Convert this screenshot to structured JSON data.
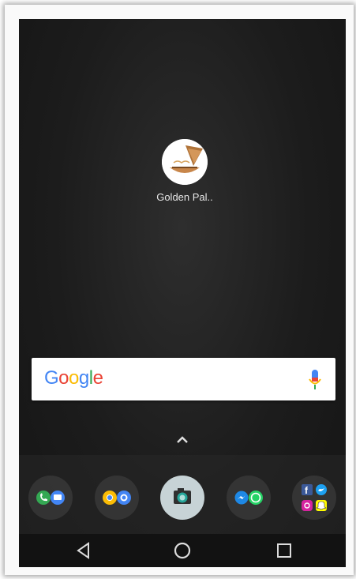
{
  "home_screen": {
    "app": {
      "label": "Golden Pal..",
      "icon": "golden-palace-icon"
    }
  },
  "search_bar": {
    "logo_text": [
      "G",
      "o",
      "o",
      "g",
      "l",
      "e"
    ],
    "logo_colors": [
      "#4285F4",
      "#EA4335",
      "#FBBC05",
      "#4285F4",
      "#34A853",
      "#EA4335"
    ],
    "mic_icon": "mic-icon"
  },
  "app_drawer_hint": {
    "icon": "chevron-up-icon"
  },
  "dock": {
    "items": [
      {
        "name": "phone-messages-folder",
        "icons": [
          "phone-icon",
          "messages-icon"
        ]
      },
      {
        "name": "chrome-folder",
        "icons": [
          "chrome-icon",
          "duo-icon"
        ]
      },
      {
        "name": "camera-app",
        "icons": [
          "camera-icon"
        ]
      },
      {
        "name": "messenger-whatsapp-folder",
        "icons": [
          "messenger-icon",
          "whatsapp-icon"
        ]
      },
      {
        "name": "social-folder",
        "icons": [
          "facebook-icon",
          "twitter-icon",
          "instagram-icon",
          "snapchat-icon"
        ]
      }
    ]
  },
  "nav_bar": {
    "back": "back-icon",
    "home": "home-icon",
    "recents": "recents-icon"
  }
}
